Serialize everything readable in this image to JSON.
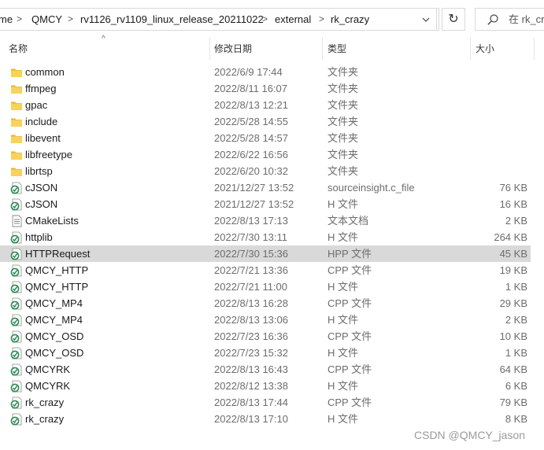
{
  "address": {
    "crumbs": [
      "me",
      "QMCY",
      "rv1126_rv1109_linux_release_20211022",
      "external",
      "rk_crazy"
    ],
    "chevron": ">",
    "dropdown_glyph": "v",
    "refresh_glyph": "↻"
  },
  "search": {
    "placeholder": "在 rk_crazy"
  },
  "columns": {
    "name": "名称",
    "date": "修改日期",
    "type": "类型",
    "size": "大小",
    "sort_glyph": "^"
  },
  "selected_index": 11,
  "files": [
    {
      "name": "common",
      "date": "2022/6/9 17:44",
      "type": "文件夹",
      "size": "",
      "icon": "folder-icon"
    },
    {
      "name": "ffmpeg",
      "date": "2022/8/11 16:07",
      "type": "文件夹",
      "size": "",
      "icon": "folder-icon"
    },
    {
      "name": "gpac",
      "date": "2022/8/13 12:21",
      "type": "文件夹",
      "size": "",
      "icon": "folder-icon"
    },
    {
      "name": "include",
      "date": "2022/5/28 14:55",
      "type": "文件夹",
      "size": "",
      "icon": "folder-icon"
    },
    {
      "name": "libevent",
      "date": "2022/5/28 14:57",
      "type": "文件夹",
      "size": "",
      "icon": "folder-icon"
    },
    {
      "name": "libfreetype",
      "date": "2022/6/22 16:56",
      "type": "文件夹",
      "size": "",
      "icon": "folder-icon"
    },
    {
      "name": "librtsp",
      "date": "2022/6/20 10:32",
      "type": "文件夹",
      "size": "",
      "icon": "folder-icon"
    },
    {
      "name": "cJSON",
      "date": "2021/12/27 13:52",
      "type": "sourceinsight.c_file",
      "size": "76 KB",
      "icon": "source-file-icon"
    },
    {
      "name": "cJSON",
      "date": "2021/12/27 13:52",
      "type": "H 文件",
      "size": "16 KB",
      "icon": "source-file-icon"
    },
    {
      "name": "CMakeLists",
      "date": "2022/8/13 17:13",
      "type": "文本文档",
      "size": "2 KB",
      "icon": "text-file-icon"
    },
    {
      "name": "httplib",
      "date": "2022/7/30 13:11",
      "type": "H 文件",
      "size": "264 KB",
      "icon": "source-file-icon"
    },
    {
      "name": "HTTPRequest",
      "date": "2022/7/30 15:36",
      "type": "HPP 文件",
      "size": "45 KB",
      "icon": "source-file-icon"
    },
    {
      "name": "QMCY_HTTP",
      "date": "2022/7/21 13:36",
      "type": "CPP 文件",
      "size": "19 KB",
      "icon": "source-file-icon"
    },
    {
      "name": "QMCY_HTTP",
      "date": "2022/7/21 11:00",
      "type": "H 文件",
      "size": "1 KB",
      "icon": "source-file-icon"
    },
    {
      "name": "QMCY_MP4",
      "date": "2022/8/13 16:28",
      "type": "CPP 文件",
      "size": "29 KB",
      "icon": "source-file-icon"
    },
    {
      "name": "QMCY_MP4",
      "date": "2022/8/13 13:06",
      "type": "H 文件",
      "size": "2 KB",
      "icon": "source-file-icon"
    },
    {
      "name": "QMCY_OSD",
      "date": "2022/7/23 16:36",
      "type": "CPP 文件",
      "size": "10 KB",
      "icon": "source-file-icon"
    },
    {
      "name": "QMCY_OSD",
      "date": "2022/7/23 15:32",
      "type": "H 文件",
      "size": "1 KB",
      "icon": "source-file-icon"
    },
    {
      "name": "QMCYRK",
      "date": "2022/8/13 16:43",
      "type": "CPP 文件",
      "size": "64 KB",
      "icon": "source-file-icon"
    },
    {
      "name": "QMCYRK",
      "date": "2022/8/12 13:38",
      "type": "H 文件",
      "size": "6 KB",
      "icon": "source-file-icon"
    },
    {
      "name": "rk_crazy",
      "date": "2022/8/13 17:44",
      "type": "CPP 文件",
      "size": "79 KB",
      "icon": "source-file-icon"
    },
    {
      "name": "rk_crazy",
      "date": "2022/8/13 17:10",
      "type": "H 文件",
      "size": "8 KB",
      "icon": "source-file-icon"
    }
  ],
  "watermark": "CSDN @QMCY_jason",
  "colors": {
    "selected_row": "#d9d9d9",
    "folder": "#f4c542",
    "source_icon": "#2e8b57"
  }
}
